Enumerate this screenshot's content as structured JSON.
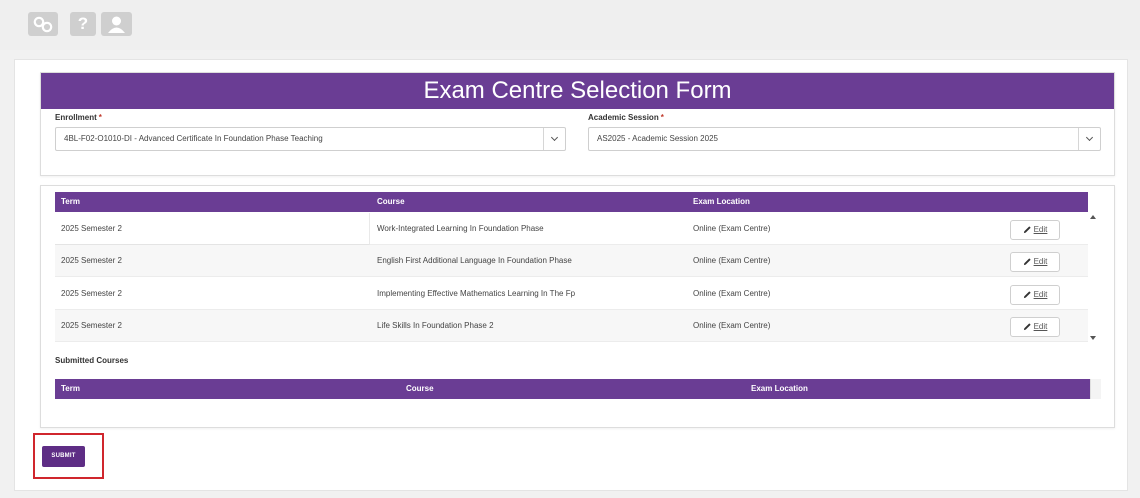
{
  "topbar": {
    "icons": [
      "link-icon",
      "help-icon",
      "user-icon"
    ],
    "help_glyph": "?"
  },
  "form": {
    "title": "Exam Centre Selection Form",
    "enrollment": {
      "label": "Enrollment",
      "required_mark": "*",
      "value": "4BL-F02-O1010-DI - Advanced Certificate In Foundation Phase Teaching"
    },
    "academic_session": {
      "label": "Academic Session",
      "required_mark": "*",
      "value": "AS2025 - Academic Session 2025"
    }
  },
  "courses_table": {
    "headers": {
      "term": "Term",
      "course": "Course",
      "location": "Exam Location"
    },
    "edit_label": "Edit",
    "rows": [
      {
        "term": "2025 Semester 2",
        "course": "Work-Integrated Learning In Foundation Phase",
        "location": "Online (Exam Centre)"
      },
      {
        "term": "2025 Semester 2",
        "course": "English First Additional Language In Foundation Phase",
        "location": "Online (Exam Centre)"
      },
      {
        "term": "2025 Semester 2",
        "course": "Implementing Effective Mathematics Learning In The Fp",
        "location": "Online (Exam Centre)"
      },
      {
        "term": "2025 Semester 2",
        "course": "Life Skills In Foundation Phase 2",
        "location": "Online (Exam Centre)"
      }
    ]
  },
  "submitted": {
    "label": "Submitted Courses",
    "headers": {
      "term": "Term",
      "course": "Course",
      "location": "Exam Location"
    }
  },
  "submit_label": "SUBMIT",
  "colors": {
    "accent": "#6a3d94",
    "submit": "#5e2d85",
    "highlight": "#d0262d"
  }
}
